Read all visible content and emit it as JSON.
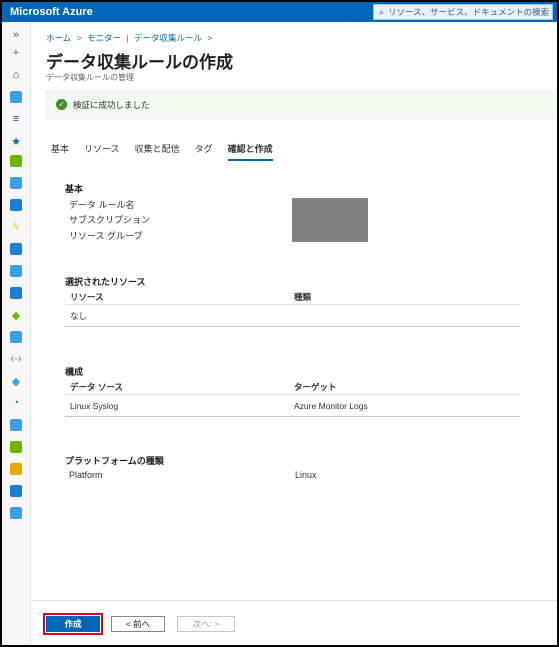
{
  "topbar": {
    "brand": "Microsoft Azure",
    "search_placeholder": "リソース、サービス、ドキュメントの検索 (G+/)",
    "search_icon": "search-icon"
  },
  "rail": {
    "icons": [
      {
        "name": "expand-icon",
        "glyph": "»",
        "color": "#605e5c"
      },
      {
        "name": "create-icon",
        "glyph": "+",
        "color": "#3c8c2a"
      },
      {
        "name": "home-icon",
        "glyph": "⌂",
        "color": "#0067b8"
      },
      {
        "name": "dashboard-icon",
        "glyph": "",
        "color": "#3aa0e8"
      },
      {
        "name": "all-services-icon",
        "glyph": "≡",
        "color": "#0067b8"
      },
      {
        "name": "favorites-icon",
        "glyph": "★",
        "color": "#0067b8"
      },
      {
        "name": "all-resources-icon",
        "glyph": "",
        "color": "#6bb700"
      },
      {
        "name": "resource-groups-icon",
        "glyph": "",
        "color": "#3aa0e8"
      },
      {
        "name": "app-services-icon",
        "glyph": "",
        "color": "#1a7fd6"
      },
      {
        "name": "function-app-icon",
        "glyph": "ϟ",
        "color": "#f2c811"
      },
      {
        "name": "sql-database-icon",
        "glyph": "",
        "color": "#1a7fd6"
      },
      {
        "name": "cosmos-db-icon",
        "glyph": "",
        "color": "#3aa0e8"
      },
      {
        "name": "virtual-machines-icon",
        "glyph": "",
        "color": "#1a7fd6"
      },
      {
        "name": "load-balancer-icon",
        "glyph": "◆",
        "color": "#6bb700"
      },
      {
        "name": "storage-accounts-icon",
        "glyph": "",
        "color": "#3aa0e8"
      },
      {
        "name": "virtual-networks-icon",
        "glyph": "‹·›",
        "color": "#1a7fd6"
      },
      {
        "name": "entra-id-icon",
        "glyph": "◆",
        "color": "#3aa0e8"
      },
      {
        "name": "monitor-icon",
        "glyph": "◔",
        "color": "#1a7fd6"
      },
      {
        "name": "advisor-icon",
        "glyph": "",
        "color": "#3aa0e8"
      },
      {
        "name": "defender-icon",
        "glyph": "",
        "color": "#6bb700"
      },
      {
        "name": "cost-management-icon",
        "glyph": "",
        "color": "#e8a600"
      },
      {
        "name": "help-support-icon",
        "glyph": "",
        "color": "#1a7fd6"
      },
      {
        "name": "advisor-tips-icon",
        "glyph": "",
        "color": "#3aa0e8"
      }
    ]
  },
  "breadcrumb": {
    "home": "ホーム",
    "monitor": "モニター",
    "sep": "|",
    "dcr": "データ収集ルール",
    "chevron": ">"
  },
  "page": {
    "title": "データ収集ルールの作成",
    "more": "…",
    "subtitle": "データ収集ルールの管理"
  },
  "banner": {
    "text": "検証に成功しました"
  },
  "tabs": [
    {
      "label": "基本"
    },
    {
      "label": "リソース"
    },
    {
      "label": "収集と配信"
    },
    {
      "label": "タグ"
    },
    {
      "label": "確認と作成",
      "active": true
    }
  ],
  "basics": {
    "heading": "基本",
    "fields": [
      "データ ルール名",
      "サブスクリプション",
      "リソース グループ"
    ]
  },
  "resources": {
    "heading": "選択されたリソース",
    "columns": [
      "リソース",
      "種類"
    ],
    "rows": [
      [
        "なし",
        ""
      ]
    ]
  },
  "config": {
    "heading": "構成",
    "columns": [
      "データ ソース",
      "ターゲット"
    ],
    "rows": [
      [
        "Linux Syslog",
        "Azure Monitor Logs"
      ]
    ]
  },
  "platform": {
    "heading": "プラットフォームの種類",
    "label": "Platform",
    "value": "Linux"
  },
  "footer": {
    "create": "作成",
    "prev": "< 前へ",
    "next": "次へ: >"
  }
}
